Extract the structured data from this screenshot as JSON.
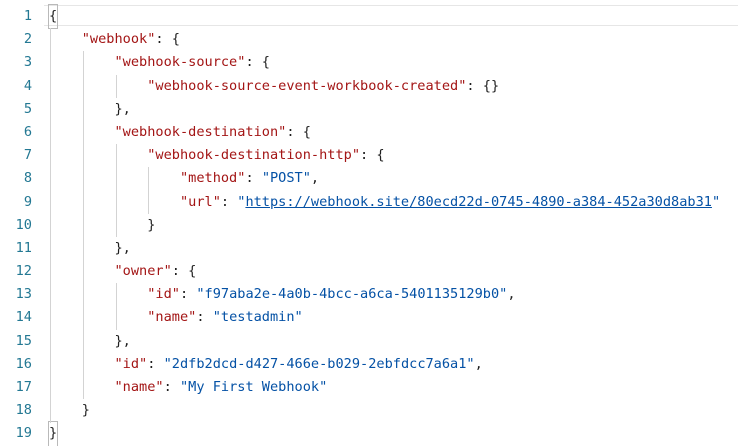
{
  "editor": {
    "line_numbers": [
      "1",
      "2",
      "3",
      "4",
      "5",
      "6",
      "7",
      "8",
      "9",
      "10",
      "11",
      "12",
      "13",
      "14",
      "15",
      "16",
      "17",
      "18",
      "19"
    ],
    "lines": [
      {
        "indent": "",
        "tokens": [
          {
            "t": "punc",
            "v": "{"
          }
        ]
      },
      {
        "indent": "    ",
        "tokens": [
          {
            "t": "key",
            "v": "\"webhook\""
          },
          {
            "t": "punc",
            "v": ": {"
          }
        ]
      },
      {
        "indent": "        ",
        "tokens": [
          {
            "t": "key",
            "v": "\"webhook-source\""
          },
          {
            "t": "punc",
            "v": ": {"
          }
        ]
      },
      {
        "indent": "            ",
        "tokens": [
          {
            "t": "key",
            "v": "\"webhook-source-event-workbook-created\""
          },
          {
            "t": "punc",
            "v": ": {}"
          }
        ]
      },
      {
        "indent": "        ",
        "tokens": [
          {
            "t": "punc",
            "v": "},"
          }
        ]
      },
      {
        "indent": "        ",
        "tokens": [
          {
            "t": "key",
            "v": "\"webhook-destination\""
          },
          {
            "t": "punc",
            "v": ": {"
          }
        ]
      },
      {
        "indent": "            ",
        "tokens": [
          {
            "t": "key",
            "v": "\"webhook-destination-http\""
          },
          {
            "t": "punc",
            "v": ": {"
          }
        ]
      },
      {
        "indent": "                ",
        "tokens": [
          {
            "t": "key",
            "v": "\"method\""
          },
          {
            "t": "punc",
            "v": ": "
          },
          {
            "t": "str",
            "v": "\"POST\""
          },
          {
            "t": "punc",
            "v": ","
          }
        ]
      },
      {
        "indent": "                ",
        "tokens": [
          {
            "t": "key",
            "v": "\"url\""
          },
          {
            "t": "punc",
            "v": ": "
          },
          {
            "t": "str",
            "v": "\""
          },
          {
            "t": "link",
            "v": "https://webhook.site/80ecd22d-0745-4890-a384-452a30d8ab31"
          },
          {
            "t": "str",
            "v": "\""
          }
        ]
      },
      {
        "indent": "            ",
        "tokens": [
          {
            "t": "punc",
            "v": "}"
          }
        ]
      },
      {
        "indent": "        ",
        "tokens": [
          {
            "t": "punc",
            "v": "},"
          }
        ]
      },
      {
        "indent": "        ",
        "tokens": [
          {
            "t": "key",
            "v": "\"owner\""
          },
          {
            "t": "punc",
            "v": ": {"
          }
        ]
      },
      {
        "indent": "            ",
        "tokens": [
          {
            "t": "key",
            "v": "\"id\""
          },
          {
            "t": "punc",
            "v": ": "
          },
          {
            "t": "str",
            "v": "\"f97aba2e-4a0b-4bcc-a6ca-5401135129b0\""
          },
          {
            "t": "punc",
            "v": ","
          }
        ]
      },
      {
        "indent": "            ",
        "tokens": [
          {
            "t": "key",
            "v": "\"name\""
          },
          {
            "t": "punc",
            "v": ": "
          },
          {
            "t": "str",
            "v": "\"testadmin\""
          }
        ]
      },
      {
        "indent": "        ",
        "tokens": [
          {
            "t": "punc",
            "v": "},"
          }
        ]
      },
      {
        "indent": "        ",
        "tokens": [
          {
            "t": "key",
            "v": "\"id\""
          },
          {
            "t": "punc",
            "v": ": "
          },
          {
            "t": "str",
            "v": "\"2dfb2dcd-d427-466e-b029-2ebfdcc7a6a1\""
          },
          {
            "t": "punc",
            "v": ","
          }
        ]
      },
      {
        "indent": "        ",
        "tokens": [
          {
            "t": "key",
            "v": "\"name\""
          },
          {
            "t": "punc",
            "v": ": "
          },
          {
            "t": "str",
            "v": "\"My First Webhook\""
          }
        ]
      },
      {
        "indent": "    ",
        "tokens": [
          {
            "t": "punc",
            "v": "}"
          }
        ]
      },
      {
        "indent": "",
        "tokens": [
          {
            "t": "punc",
            "v": "}"
          }
        ]
      }
    ]
  },
  "colors": {
    "line_number": "#237893",
    "key": "#a31515",
    "string": "#0451a5",
    "punctuation": "#1f1f1f",
    "indent_guide": "#d3d3d3",
    "current_line_border": "#e6e6e6"
  }
}
